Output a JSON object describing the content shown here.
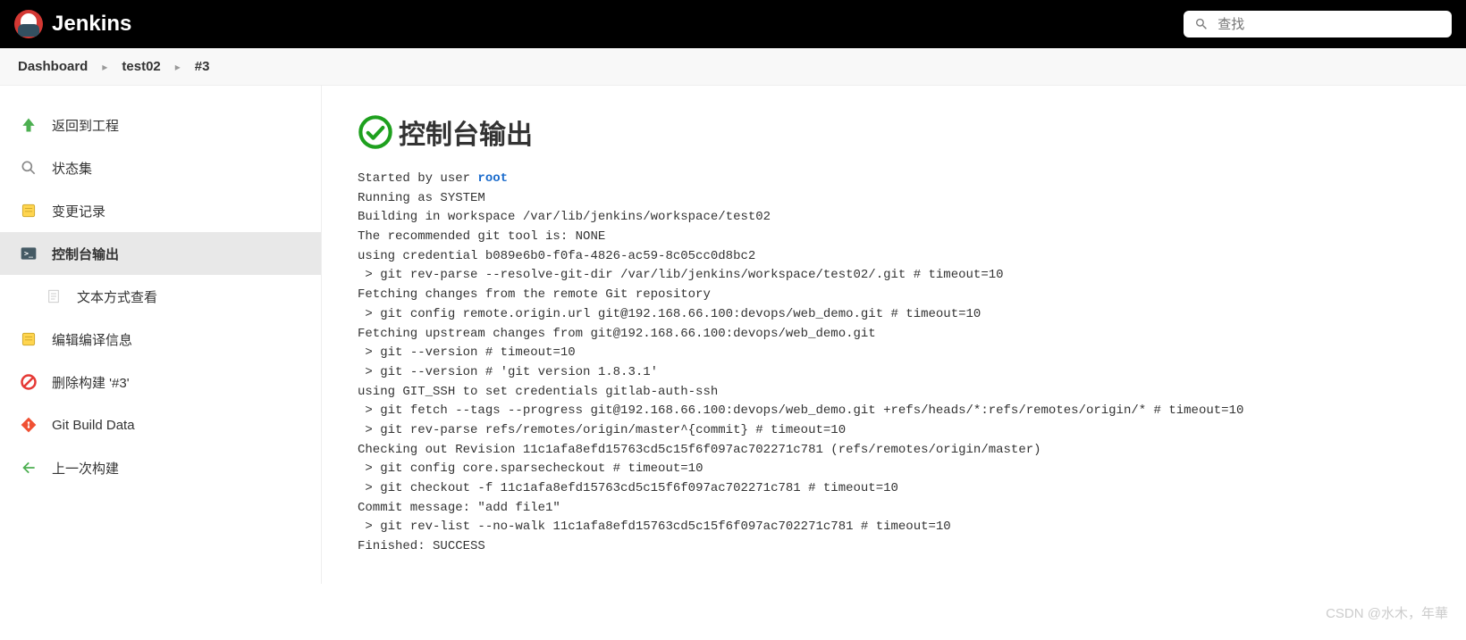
{
  "header": {
    "brand": "Jenkins",
    "search_placeholder": "查找"
  },
  "breadcrumb": [
    {
      "label": "Dashboard"
    },
    {
      "label": "test02"
    },
    {
      "label": "#3"
    }
  ],
  "sidebar": {
    "items": [
      {
        "icon": "arrow-up",
        "label": "返回到工程"
      },
      {
        "icon": "magnifier",
        "label": "状态集"
      },
      {
        "icon": "notepad",
        "label": "变更记录"
      },
      {
        "icon": "terminal",
        "label": "控制台输出",
        "active": true
      },
      {
        "icon": "document",
        "label": "文本方式查看",
        "sub": true
      },
      {
        "icon": "notepad",
        "label": "编辑编译信息"
      },
      {
        "icon": "forbid",
        "label": "删除构建 '#3'"
      },
      {
        "icon": "git",
        "label": "Git Build Data"
      },
      {
        "icon": "arrow-left",
        "label": "上一次构建"
      }
    ]
  },
  "page": {
    "title": "控制台输出",
    "started_prefix": "Started by user ",
    "started_user": "root",
    "console_lines": [
      "Running as SYSTEM",
      "Building in workspace /var/lib/jenkins/workspace/test02",
      "The recommended git tool is: NONE",
      "using credential b089e6b0-f0fa-4826-ac59-8c05cc0d8bc2",
      " > git rev-parse --resolve-git-dir /var/lib/jenkins/workspace/test02/.git # timeout=10",
      "Fetching changes from the remote Git repository",
      " > git config remote.origin.url git@192.168.66.100:devops/web_demo.git # timeout=10",
      "Fetching upstream changes from git@192.168.66.100:devops/web_demo.git",
      " > git --version # timeout=10",
      " > git --version # 'git version 1.8.3.1'",
      "using GIT_SSH to set credentials gitlab-auth-ssh",
      " > git fetch --tags --progress git@192.168.66.100:devops/web_demo.git +refs/heads/*:refs/remotes/origin/* # timeout=10",
      " > git rev-parse refs/remotes/origin/master^{commit} # timeout=10",
      "Checking out Revision 11c1afa8efd15763cd5c15f6f097ac702271c781 (refs/remotes/origin/master)",
      " > git config core.sparsecheckout # timeout=10",
      " > git checkout -f 11c1afa8efd15763cd5c15f6f097ac702271c781 # timeout=10",
      "Commit message: \"add file1\"",
      " > git rev-list --no-walk 11c1afa8efd15763cd5c15f6f097ac702271c781 # timeout=10",
      "Finished: SUCCESS"
    ]
  },
  "watermark": "CSDN @水木，年華"
}
